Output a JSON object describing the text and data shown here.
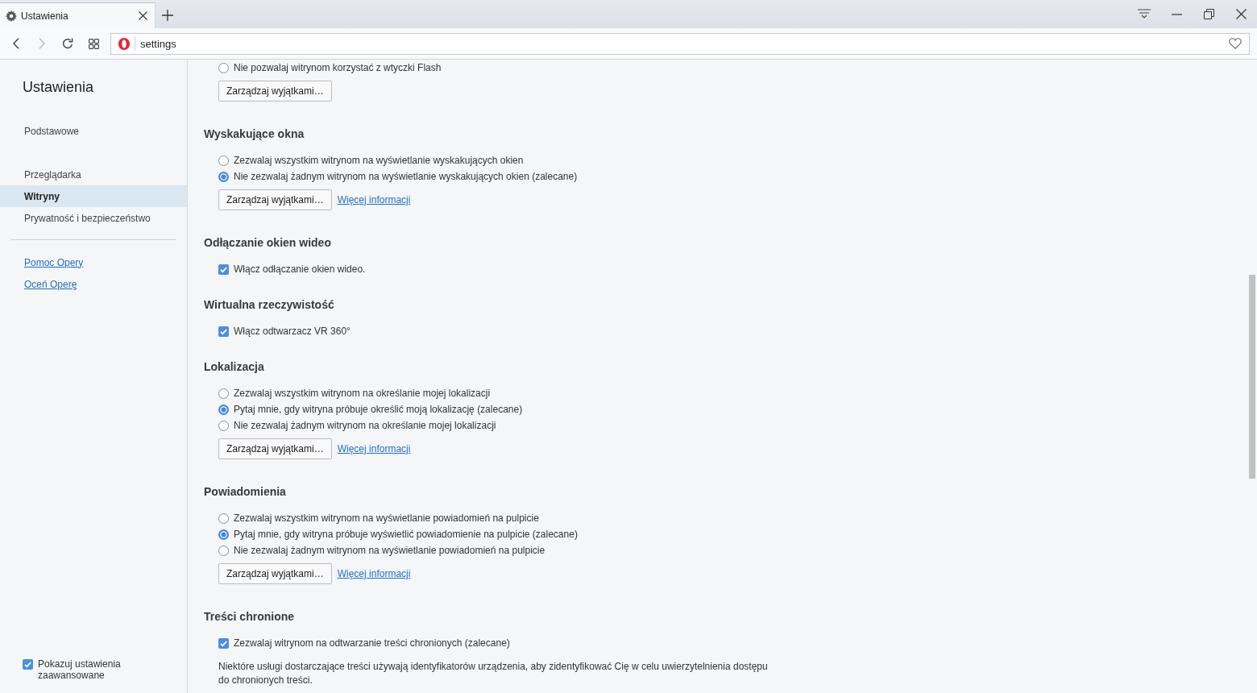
{
  "tab_bar": {
    "tabs": [
      {
        "title": "Ustawienia",
        "selected": true
      }
    ]
  },
  "toolbar": {
    "buttons": [
      {
        "kind": "back",
        "disabled": false
      },
      {
        "kind": "forward",
        "disabled": true
      },
      {
        "kind": "reload",
        "disabled": false
      },
      {
        "kind": "speed_dial",
        "disabled": false
      }
    ],
    "address": {
      "value": "settings"
    }
  },
  "sidebar": {
    "title": "Ustawienia",
    "nav_groups": [
      {
        "items": [
          {
            "label": "Podstawowe",
            "selected": false
          }
        ]
      },
      {
        "items": [
          {
            "label": "Przeglądarka",
            "selected": false
          },
          {
            "label": "Witryny",
            "selected": true
          },
          {
            "label": "Prywatność i bezpieczeństwo",
            "selected": false
          }
        ]
      }
    ],
    "links": [
      "Pomoc Opery",
      "Oceń Operę"
    ],
    "advanced_toggle": {
      "label": "Pokazuj ustawienia zaawansowane",
      "checked": true
    }
  },
  "content": {
    "sections": [
      {
        "options": [
          {
            "kind": "radio",
            "label": "Nie pozwalaj witrynom korzystać z wtyczki Flash",
            "selected": false
          }
        ],
        "manage_button": "Zarządzaj wyjątkami…"
      },
      {
        "heading": "Wyskakujące okna",
        "options": [
          {
            "kind": "radio",
            "label": "Zezwalaj wszystkim witrynom na wyświetlanie wyskakujących okien",
            "selected": false
          },
          {
            "kind": "radio",
            "label": "Nie zezwalaj żadnym witrynom na wyświetlanie wyskakujących okien (zalecane)",
            "selected": true
          }
        ],
        "manage_button": "Zarządzaj wyjątkami…",
        "more_info_link": "Więcej informacji"
      },
      {
        "heading": "Odłączanie okien wideo",
        "options": [
          {
            "kind": "checkbox",
            "label": "Włącz odłączanie okien wideo.",
            "checked": true
          }
        ]
      },
      {
        "heading": "Wirtualna rzeczywistość",
        "options": [
          {
            "kind": "checkbox",
            "label": "Włącz odtwarzacz VR 360°",
            "checked": true
          }
        ]
      },
      {
        "heading": "Lokalizacja",
        "options": [
          {
            "kind": "radio",
            "label": "Zezwalaj wszystkim witrynom na określanie mojej lokalizacji",
            "selected": false
          },
          {
            "kind": "radio",
            "label": "Pytaj mnie, gdy witryna próbuje określić moją lokalizację (zalecane)",
            "selected": true
          },
          {
            "kind": "radio",
            "label": "Nie zezwalaj żadnym witrynom na określanie mojej lokalizacji",
            "selected": false
          }
        ],
        "manage_button": "Zarządzaj wyjątkami…",
        "more_info_link": "Więcej informacji"
      },
      {
        "heading": "Powiadomienia",
        "options": [
          {
            "kind": "radio",
            "label": "Zezwalaj wszystkim witrynom na wyświetlanie powiadomień na pulpicie",
            "selected": false
          },
          {
            "kind": "radio",
            "label": "Pytaj mnie, gdy witryna próbuje wyświetlić powiadomienie na pulpicie (zalecane)",
            "selected": true
          },
          {
            "kind": "radio",
            "label": "Nie zezwalaj żadnym witrynom na wyświetlanie powiadomień na pulpicie",
            "selected": false
          }
        ],
        "manage_button": "Zarządzaj wyjątkami…",
        "more_info_link": "Więcej informacji"
      },
      {
        "heading": "Treści chronione",
        "options": [
          {
            "kind": "checkbox",
            "label": "Zezwalaj witrynom na odtwarzanie treści chronionych (zalecane)",
            "checked": true
          }
        ],
        "note": "Niektóre usługi dostarczające treści używają identyfikatorów urządzenia, aby zidentyfikować Cię w celu uwierzytelnienia dostępu do chronionych treści."
      }
    ]
  }
}
